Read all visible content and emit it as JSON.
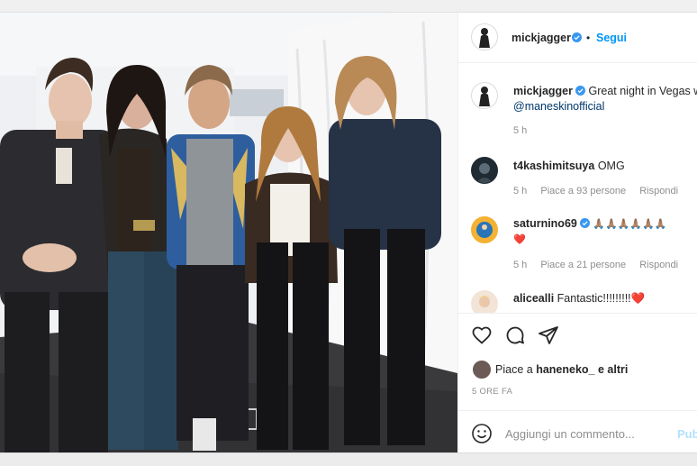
{
  "header": {
    "username": "mickjagger",
    "separator": "•",
    "follow_label": "Segui"
  },
  "caption": {
    "username": "mickjagger",
    "text": "Great night in Vegas with",
    "mention": "@maneskinofficial",
    "time": "5 h"
  },
  "comments": [
    {
      "username": "t4kashimitsuya",
      "text": "OMG",
      "time": "5 h",
      "likes": "Piace a 93 persone",
      "reply": "Rispondi"
    },
    {
      "username": "saturnino69",
      "text": "🙏🏽🙏🏽🙏🏽🙏🏽🙏🏽🙏🏽",
      "heart": "❤️",
      "time": "5 h",
      "likes": "Piace a 21 persone",
      "reply": "Rispondi"
    },
    {
      "username": "alicealli",
      "text": "Fantastic!!!!!!!!!",
      "heart": "❤️"
    }
  ],
  "actions": {
    "likes_prefix": "Piace a",
    "likes_user": "haneneko_",
    "likes_suffix": "e altri",
    "time_ago": "5 ORE FA",
    "comment_placeholder": "Aggiungi un commento...",
    "post_label": "Pubblica"
  },
  "colors": {
    "accent": "#0095f6",
    "verified": "#3897f0",
    "heart": "#ed4956"
  },
  "icons": [
    "heart-icon",
    "comment-icon",
    "share-icon",
    "emoji-icon",
    "verified-badge-icon"
  ]
}
